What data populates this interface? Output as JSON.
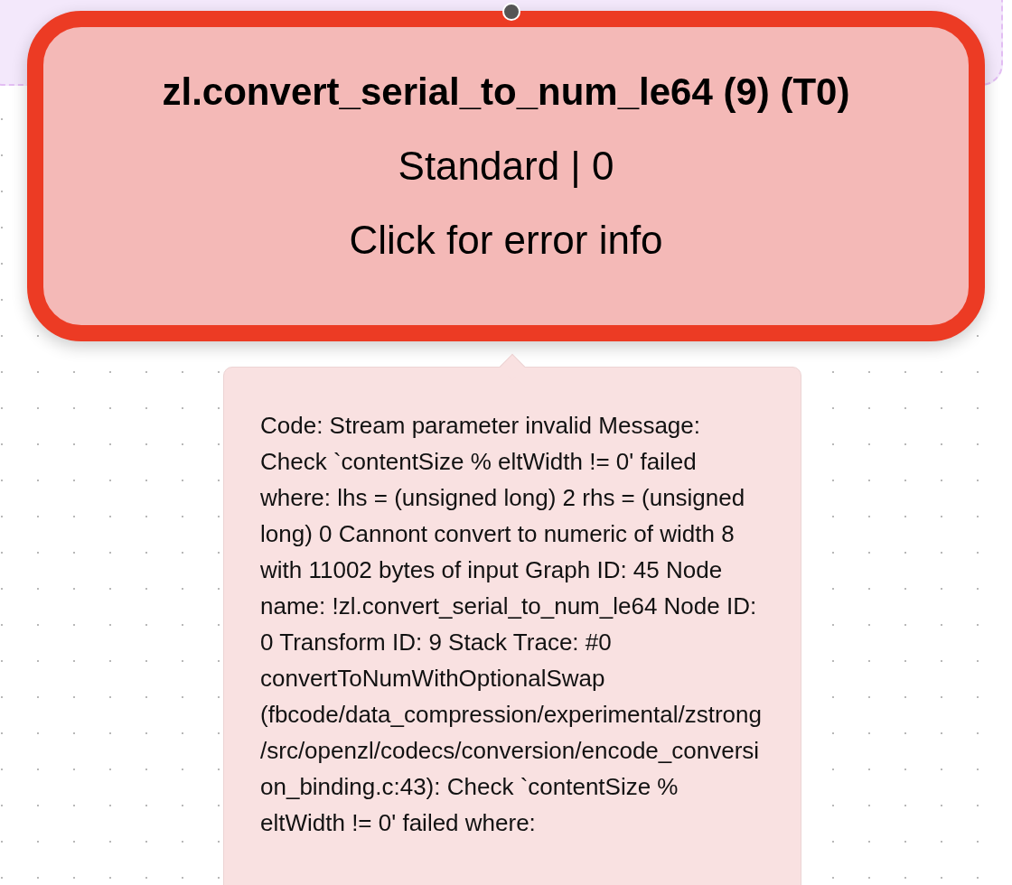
{
  "node": {
    "title": "zl.convert_serial_to_num_le64 (9) (T0)",
    "subtitle": "Standard | 0",
    "hint": "Click for error info",
    "error": true
  },
  "tooltip": {
    "text": "Code: Stream parameter invalid Message: Check `contentSize % eltWidth != 0' failed where: lhs = (unsigned long) 2 rhs = (unsigned long) 0 Cannont convert to numeric of width 8 with 11002 bytes of input Graph ID: 45 Node name: !zl.convert_serial_to_num_le64 Node ID: 0 Transform ID: 9 Stack Trace: #0 convertToNumWithOptionalSwap (fbcode/data_compression/experimental/zstrong/src/openzl/codecs/conversion/encode_conversion_binding.c:43): Check `contentSize % eltWidth != 0' failed where:"
  }
}
